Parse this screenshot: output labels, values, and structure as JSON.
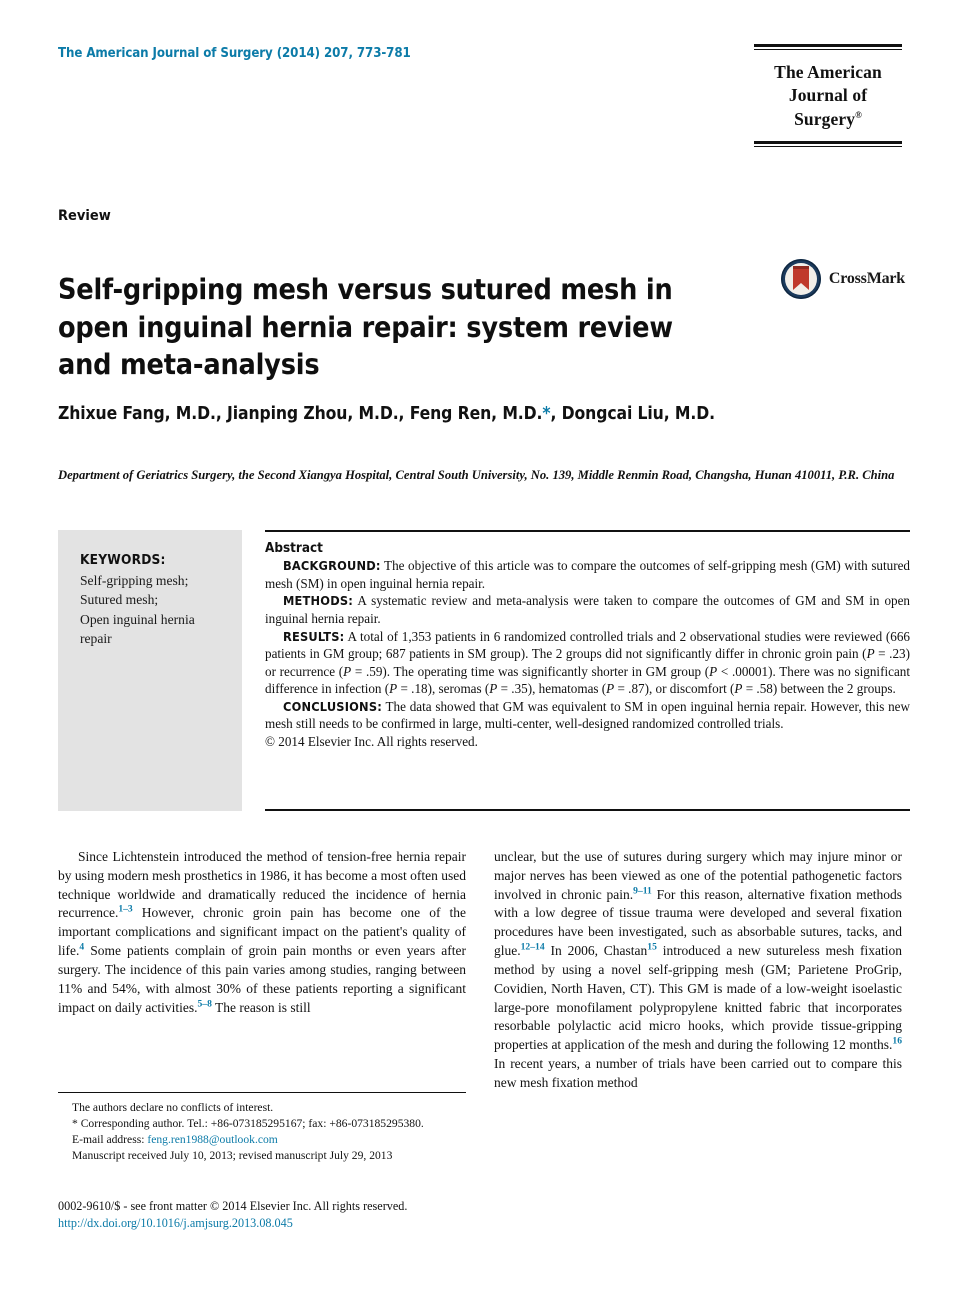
{
  "header": {
    "journal_reference": "The American Journal of Surgery (2014) 207, 773-781",
    "logo_line1": "The American",
    "logo_line2": "Journal of Surgery"
  },
  "article": {
    "type": "Review",
    "title": "Self-gripping mesh versus sutured mesh in open inguinal hernia repair: system review and meta-analysis",
    "crossmark_label": "CrossMark",
    "authors": "Zhixue Fang, M.D., Jianping Zhou, M.D., Feng Ren, M.D.",
    "authors_suffix": ", Dongcai Liu, M.D.",
    "corresponding_marker": "*",
    "affiliation": "Department of Geriatrics Surgery, the Second Xiangya Hospital, Central South University, No. 139, Middle Renmin Road, Changsha, Hunan 410011, P.R. China"
  },
  "keywords": {
    "title": "KEYWORDS:",
    "items": [
      "Self-gripping mesh;",
      "Sutured mesh;",
      "Open inguinal hernia",
      "repair"
    ]
  },
  "abstract": {
    "heading": "Abstract",
    "background_label": "BACKGROUND:",
    "background_text": "The objective of this article was to compare the outcomes of self-gripping mesh (GM) with sutured mesh (SM) in open inguinal hernia repair.",
    "methods_label": "METHODS:",
    "methods_text": "A systematic review and meta-analysis were taken to compare the outcomes of GM and SM in open inguinal hernia repair.",
    "results_label": "RESULTS:",
    "results_text_1": "A total of 1,353 patients in 6 randomized controlled trials and 2 observational studies were reviewed (666 patients in GM group; 687 patients in SM group). The 2 groups did not significantly differ in chronic groin pain (",
    "results_p1": "P",
    "results_text_2": " = .23) or recurrence (",
    "results_p2": "P",
    "results_text_3": " = .59). The operating time was significantly shorter in GM group (",
    "results_p3": "P",
    "results_text_4": " < .00001). There was no significant difference in infection (",
    "results_p4": "P",
    "results_text_5": " = .18), seromas (",
    "results_p5": "P",
    "results_text_6": " = .35), hematomas (",
    "results_p6": "P",
    "results_text_7": " = .87), or discomfort (",
    "results_p7": "P",
    "results_text_8": " = .58) between the 2 groups.",
    "conclusions_label": "CONCLUSIONS:",
    "conclusions_text": "The data showed that GM was equivalent to SM in open inguinal hernia repair. However, this new mesh still needs to be confirmed in large, multi-center, well-designed randomized controlled trials.",
    "copyright": "© 2014 Elsevier Inc. All rights reserved."
  },
  "body": {
    "left_column": {
      "part1": "Since Lichtenstein introduced the method of tension-free hernia repair by using modern mesh prosthetics in 1986, it has become a most often used technique worldwide and dramatically reduced the incidence of hernia recurrence.",
      "ref1": "1–3",
      "part2": " However, chronic groin pain has become one of the important complications and significant impact on the patient's quality of life.",
      "ref2": "4",
      "part3": " Some patients complain of groin pain months or even years after surgery. The incidence of this pain varies among studies, ranging between 11% and 54%, with almost 30% of these patients reporting a significant impact on daily activities.",
      "ref3": "5–8",
      "part4": " The reason is still"
    },
    "right_column": {
      "part1": "unclear, but the use of sutures during surgery which may injure minor or major nerves has been viewed as one of the potential pathogenetic factors involved in chronic pain.",
      "ref1": "9–11",
      "part2": " For this reason, alternative fixation methods with a low degree of tissue trauma were developed and several fixation procedures have been investigated, such as absorbable sutures, tacks, and glue.",
      "ref2": "12–14",
      "part3": " In 2006, Chastan",
      "ref3": "15",
      "part4": " introduced a new sutureless mesh fixation method by using a novel self-gripping mesh (GM; Parietene ProGrip, Covidien, North Haven, CT). This GM is made of a low-weight isoelastic large-pore monofilament polypropylene knitted fabric that incorporates resorbable polylactic acid micro hooks, which provide tissue-gripping properties at application of the mesh and during the following 12 months.",
      "ref4": "16",
      "part5": " In recent years, a number of trials have been carried out to compare this new mesh fixation method"
    }
  },
  "footnotes": {
    "conflict": "The authors declare no conflicts of interest.",
    "corresponding": "* Corresponding author. Tel.: +86-073185295167; fax: +86-073185295380.",
    "email_label": "E-mail address:",
    "email": "feng.ren1988@outlook.com",
    "manuscript": "Manuscript received July 10, 2013; revised manuscript July 29, 2013"
  },
  "page_footer": {
    "issn_line": "0002-9610/$ - see front matter © 2014 Elsevier Inc. All rights reserved.",
    "doi": "http://dx.doi.org/10.1016/j.amjsurg.2013.08.045"
  },
  "colors": {
    "link": "#0c7ba8",
    "keywords_background": "#e3e3e3",
    "text": "#111111",
    "crossmark_ring": "#1b3a5c",
    "crossmark_ribbon": "#c0392b"
  }
}
